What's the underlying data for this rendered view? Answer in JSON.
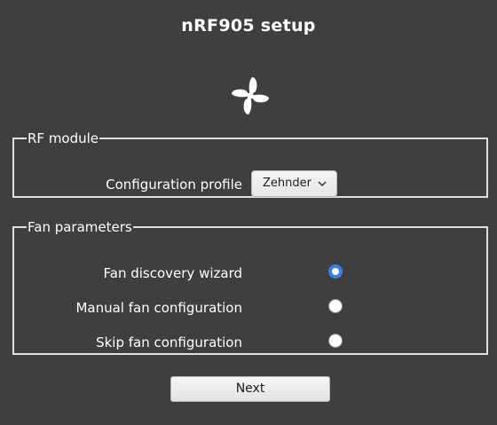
{
  "header": {
    "title": "nRF905 setup",
    "logo_icon": "fan-icon"
  },
  "rf_module": {
    "legend": "RF module",
    "config_profile_label": "Configuration profile",
    "config_profile_value": "Zehnder",
    "dropdown_icon": "chevron-down-icon"
  },
  "fan_parameters": {
    "legend": "Fan parameters",
    "options": [
      {
        "label": "Fan discovery wizard",
        "checked": true
      },
      {
        "label": "Manual fan configuration",
        "checked": false
      },
      {
        "label": "Skip fan configuration",
        "checked": false
      }
    ]
  },
  "actions": {
    "next_label": "Next"
  },
  "colors": {
    "background": "#3f3f3f",
    "radio_accent": "#3d7fe0",
    "text": "#ffffff"
  }
}
